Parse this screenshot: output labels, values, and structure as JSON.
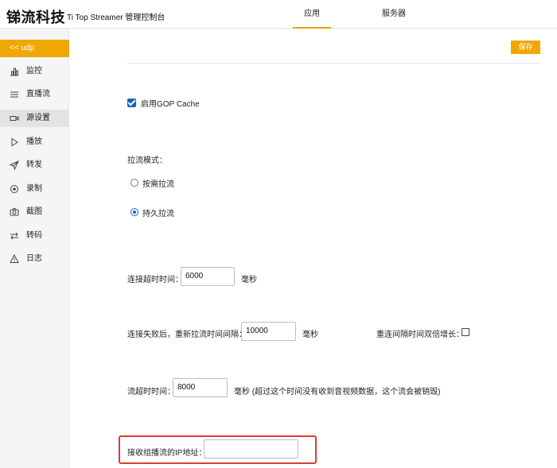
{
  "header": {
    "brand": "锑流科技",
    "subtitle": "Ti Top Streamer 管理控制台",
    "tabs": [
      {
        "label": "应用",
        "active": true
      },
      {
        "label": "服务器",
        "active": false
      }
    ]
  },
  "sidebar": {
    "back_label": "<<  udp",
    "items": [
      {
        "label": "监控",
        "icon": "bar-chart-icon"
      },
      {
        "label": "直播流",
        "icon": "list-icon"
      },
      {
        "label": "源设置",
        "icon": "video-camera-icon",
        "active": true
      },
      {
        "label": "播放",
        "icon": "play-icon"
      },
      {
        "label": "转发",
        "icon": "send-icon"
      },
      {
        "label": "录制",
        "icon": "record-icon"
      },
      {
        "label": "截图",
        "icon": "camera-icon"
      },
      {
        "label": "转码",
        "icon": "transcode-icon"
      },
      {
        "label": "日志",
        "icon": "warning-icon"
      }
    ]
  },
  "toolbar": {
    "save_label": "保存"
  },
  "form": {
    "gop_cache": {
      "label": "启用GOP Cache",
      "checked": true
    },
    "pull_mode": {
      "label": "拉流模式：",
      "options": [
        {
          "label": "按需拉流",
          "selected": false
        },
        {
          "label": "持久拉流",
          "selected": true
        }
      ]
    },
    "connect_timeout": {
      "label": "连接超时时间：",
      "value": "6000",
      "unit": "毫秒"
    },
    "retry_interval": {
      "label": "连接失败后，重新拉流时间间隔：",
      "value": "10000",
      "unit": "毫秒"
    },
    "retry_double": {
      "label": "重连间隔时间双倍增长：",
      "checked": false
    },
    "stream_timeout": {
      "label": "流超时时间：",
      "value": "8000",
      "unit": "毫秒 (超过这个时间没有收到音视频数据，这个流会被销毁)"
    },
    "multicast_ip": {
      "label": "接收组播流的IP地址：",
      "value": ""
    }
  },
  "colors": {
    "accent": "#f0a800",
    "check": "#1565c0",
    "highlight": "#e53935"
  }
}
